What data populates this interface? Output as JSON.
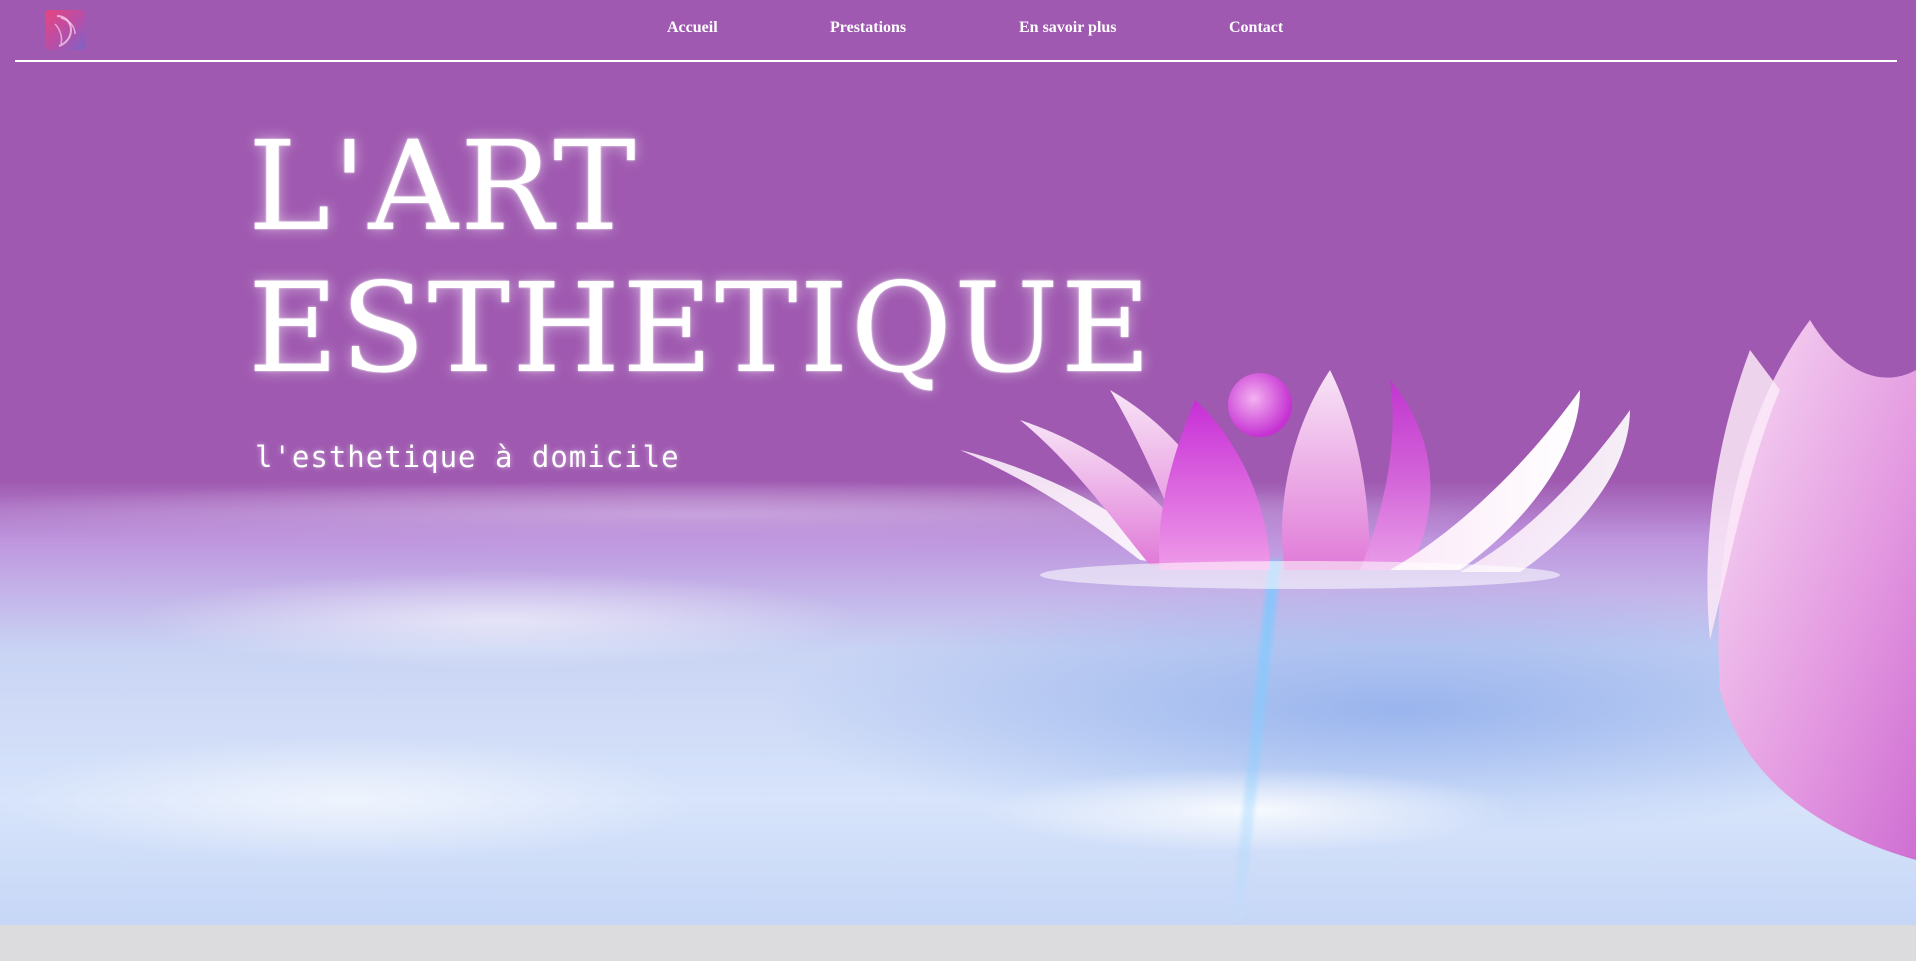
{
  "nav": {
    "logo_icon": "lotus-face-logo-icon",
    "links": [
      {
        "label": "Accueil"
      },
      {
        "label": "Prestations"
      },
      {
        "label": "En savoir plus"
      },
      {
        "label": "Contact"
      }
    ]
  },
  "hero": {
    "title_line1": "L'ART",
    "title_line2": "ESTHETIQUE",
    "subtitle": "l'esthetique à domicile",
    "background_image": "lotus-on-water-image"
  },
  "colors": {
    "hero_background": "#9f59b0",
    "nav_text": "#ffffff",
    "lotus_pink": "#d33fd8",
    "water_light": "#d7e4fb"
  }
}
